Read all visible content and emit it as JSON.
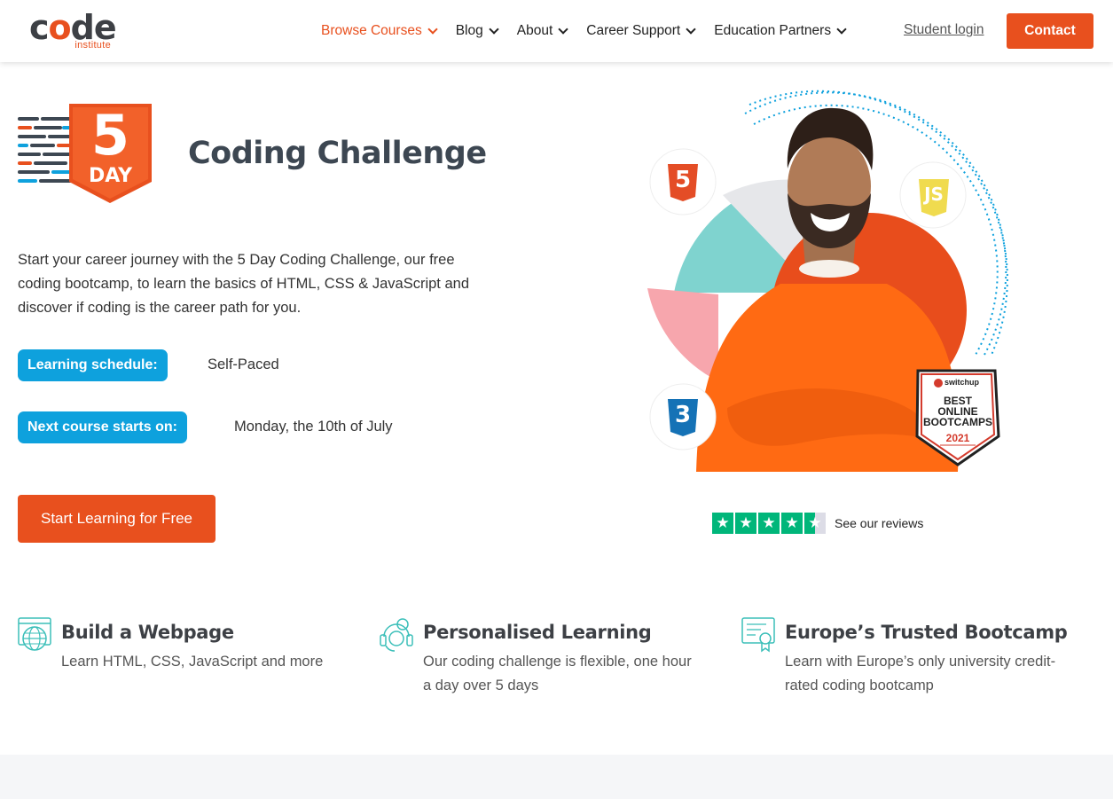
{
  "header": {
    "logo": {
      "word": "code",
      "sub": "institute"
    },
    "nav": [
      {
        "label": "Browse Courses",
        "active": true
      },
      {
        "label": "Blog",
        "active": false
      },
      {
        "label": "About",
        "active": false
      },
      {
        "label": "Career Support",
        "active": false
      },
      {
        "label": "Education Partners",
        "active": false
      }
    ],
    "student_login": "Student login",
    "contact": "Contact"
  },
  "hero": {
    "badge": {
      "number": "5",
      "unit": "DAY"
    },
    "title": "Coding Challenge",
    "description": "Start your career journey with the 5 Day Coding Challenge, our free coding bootcamp, to learn the basics of HTML, CSS & JavaScript and discover if coding is the career path for you.",
    "schedule_label": "Learning schedule:",
    "schedule_value": "Self-Paced",
    "start_label": "Next course starts on:",
    "start_value": "Monday, the 10th of July",
    "cta": "Start Learning for Free",
    "art": {
      "html_badge": "5",
      "js_badge": "JS",
      "css_badge": "3",
      "award": {
        "brand": "switchup",
        "line1": "BEST",
        "line2": "ONLINE",
        "line3": "BOOTCAMPS",
        "year": "2021"
      }
    },
    "reviews": {
      "rating": 4.5,
      "max": 5,
      "text": "See our reviews"
    }
  },
  "features": [
    {
      "icon": "globe-webpage-icon",
      "title": "Build a Webpage",
      "desc": "Learn HTML, CSS, JavaScript and more"
    },
    {
      "icon": "headset-support-icon",
      "title": "Personalised Learning",
      "desc": "Our coding challenge is flexible, one hour a day over 5 days"
    },
    {
      "icon": "certificate-icon",
      "title": "Europe’s Trusted Bootcamp",
      "desc": "Learn with Europe’s only university credit-rated coding bootcamp"
    }
  ],
  "colors": {
    "brand_orange": "#e8501e",
    "pill_blue": "#0ea1dd",
    "trustpilot_green": "#00b67a",
    "dark_text": "#3d4752",
    "teal_icon": "#3bbfb9"
  }
}
